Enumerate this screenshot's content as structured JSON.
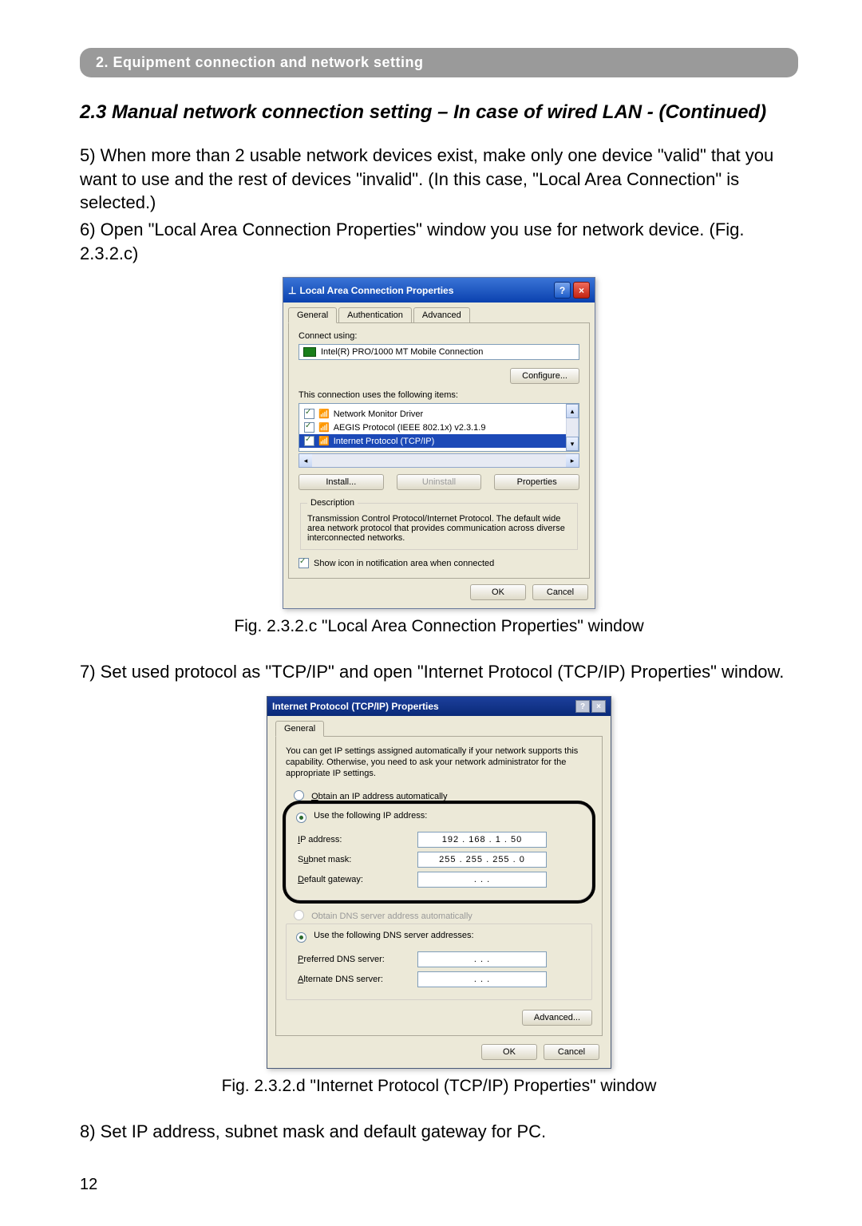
{
  "breadcrumb": "2. Equipment connection and network setting",
  "section_title": "2.3 Manual network connection setting – In case of wired LAN - (Continued)",
  "para5": "5) When more than 2 usable network devices exist, make only one device \"valid\" that you want to use and the rest of devices \"invalid\". (In this case, \"Local Area Connection\" is selected.)",
  "para6": "6) Open \"Local Area Connection Properties\" window you use for network device. (Fig. 2.3.2.c)",
  "fig1_caption": "Fig. 2.3.2.c \"Local Area Connection Properties\" window",
  "para7": "7) Set used protocol as \"TCP/IP\" and open \"Internet Protocol (TCP/IP) Properties\" window.",
  "fig2_caption": "Fig. 2.3.2.d \"Internet Protocol (TCP/IP) Properties\" window",
  "para8": "8) Set IP address, subnet mask and default gateway for PC.",
  "page_number": "12",
  "dialog1": {
    "title": "Local Area Connection Properties",
    "help_glyph": "?",
    "close_glyph": "×",
    "tabs": {
      "general": "General",
      "auth": "Authentication",
      "adv": "Advanced"
    },
    "connect_label": "Connect using:",
    "nic": "Intel(R) PRO/1000 MT Mobile Connection",
    "configure": "Configure...",
    "items_label": "This connection uses the following items:",
    "item1": "Network Monitor Driver",
    "item2": "AEGIS Protocol (IEEE 802.1x) v2.3.1.9",
    "item3": "Internet Protocol (TCP/IP)",
    "install": "Install...",
    "uninstall": "Uninstall",
    "properties": "Properties",
    "desc_label": "Description",
    "desc_text": "Transmission Control Protocol/Internet Protocol. The default wide area network protocol that provides communication across diverse interconnected networks.",
    "show_icon": "Show icon in notification area when connected",
    "ok": "OK",
    "cancel": "Cancel"
  },
  "dialog2": {
    "title": "Internet Protocol (TCP/IP) Properties",
    "help_glyph": "?",
    "close_glyph": "×",
    "tab_general": "General",
    "info": "You can get IP settings assigned automatically if your network supports this capability. Otherwise, you need to ask your network administrator for the appropriate IP settings.",
    "r_auto_ip": "Obtain an IP address automatically",
    "r_manual_ip": "Use the following IP address:",
    "row_ip": "IP address:",
    "row_mask": "Subnet mask:",
    "row_gw": "Default gateway:",
    "ip_value": "192 . 168 .   1  .  50",
    "mask_value": "255 . 255 . 255 .   0",
    "gw_value": ".       .       .",
    "r_auto_dns": "Obtain DNS server address automatically",
    "r_manual_dns": "Use the following DNS server addresses:",
    "row_pdns": "Preferred DNS server:",
    "row_adns": "Alternate DNS server:",
    "dns_blank": ".       .       .",
    "advanced": "Advanced...",
    "ok": "OK",
    "cancel": "Cancel"
  }
}
